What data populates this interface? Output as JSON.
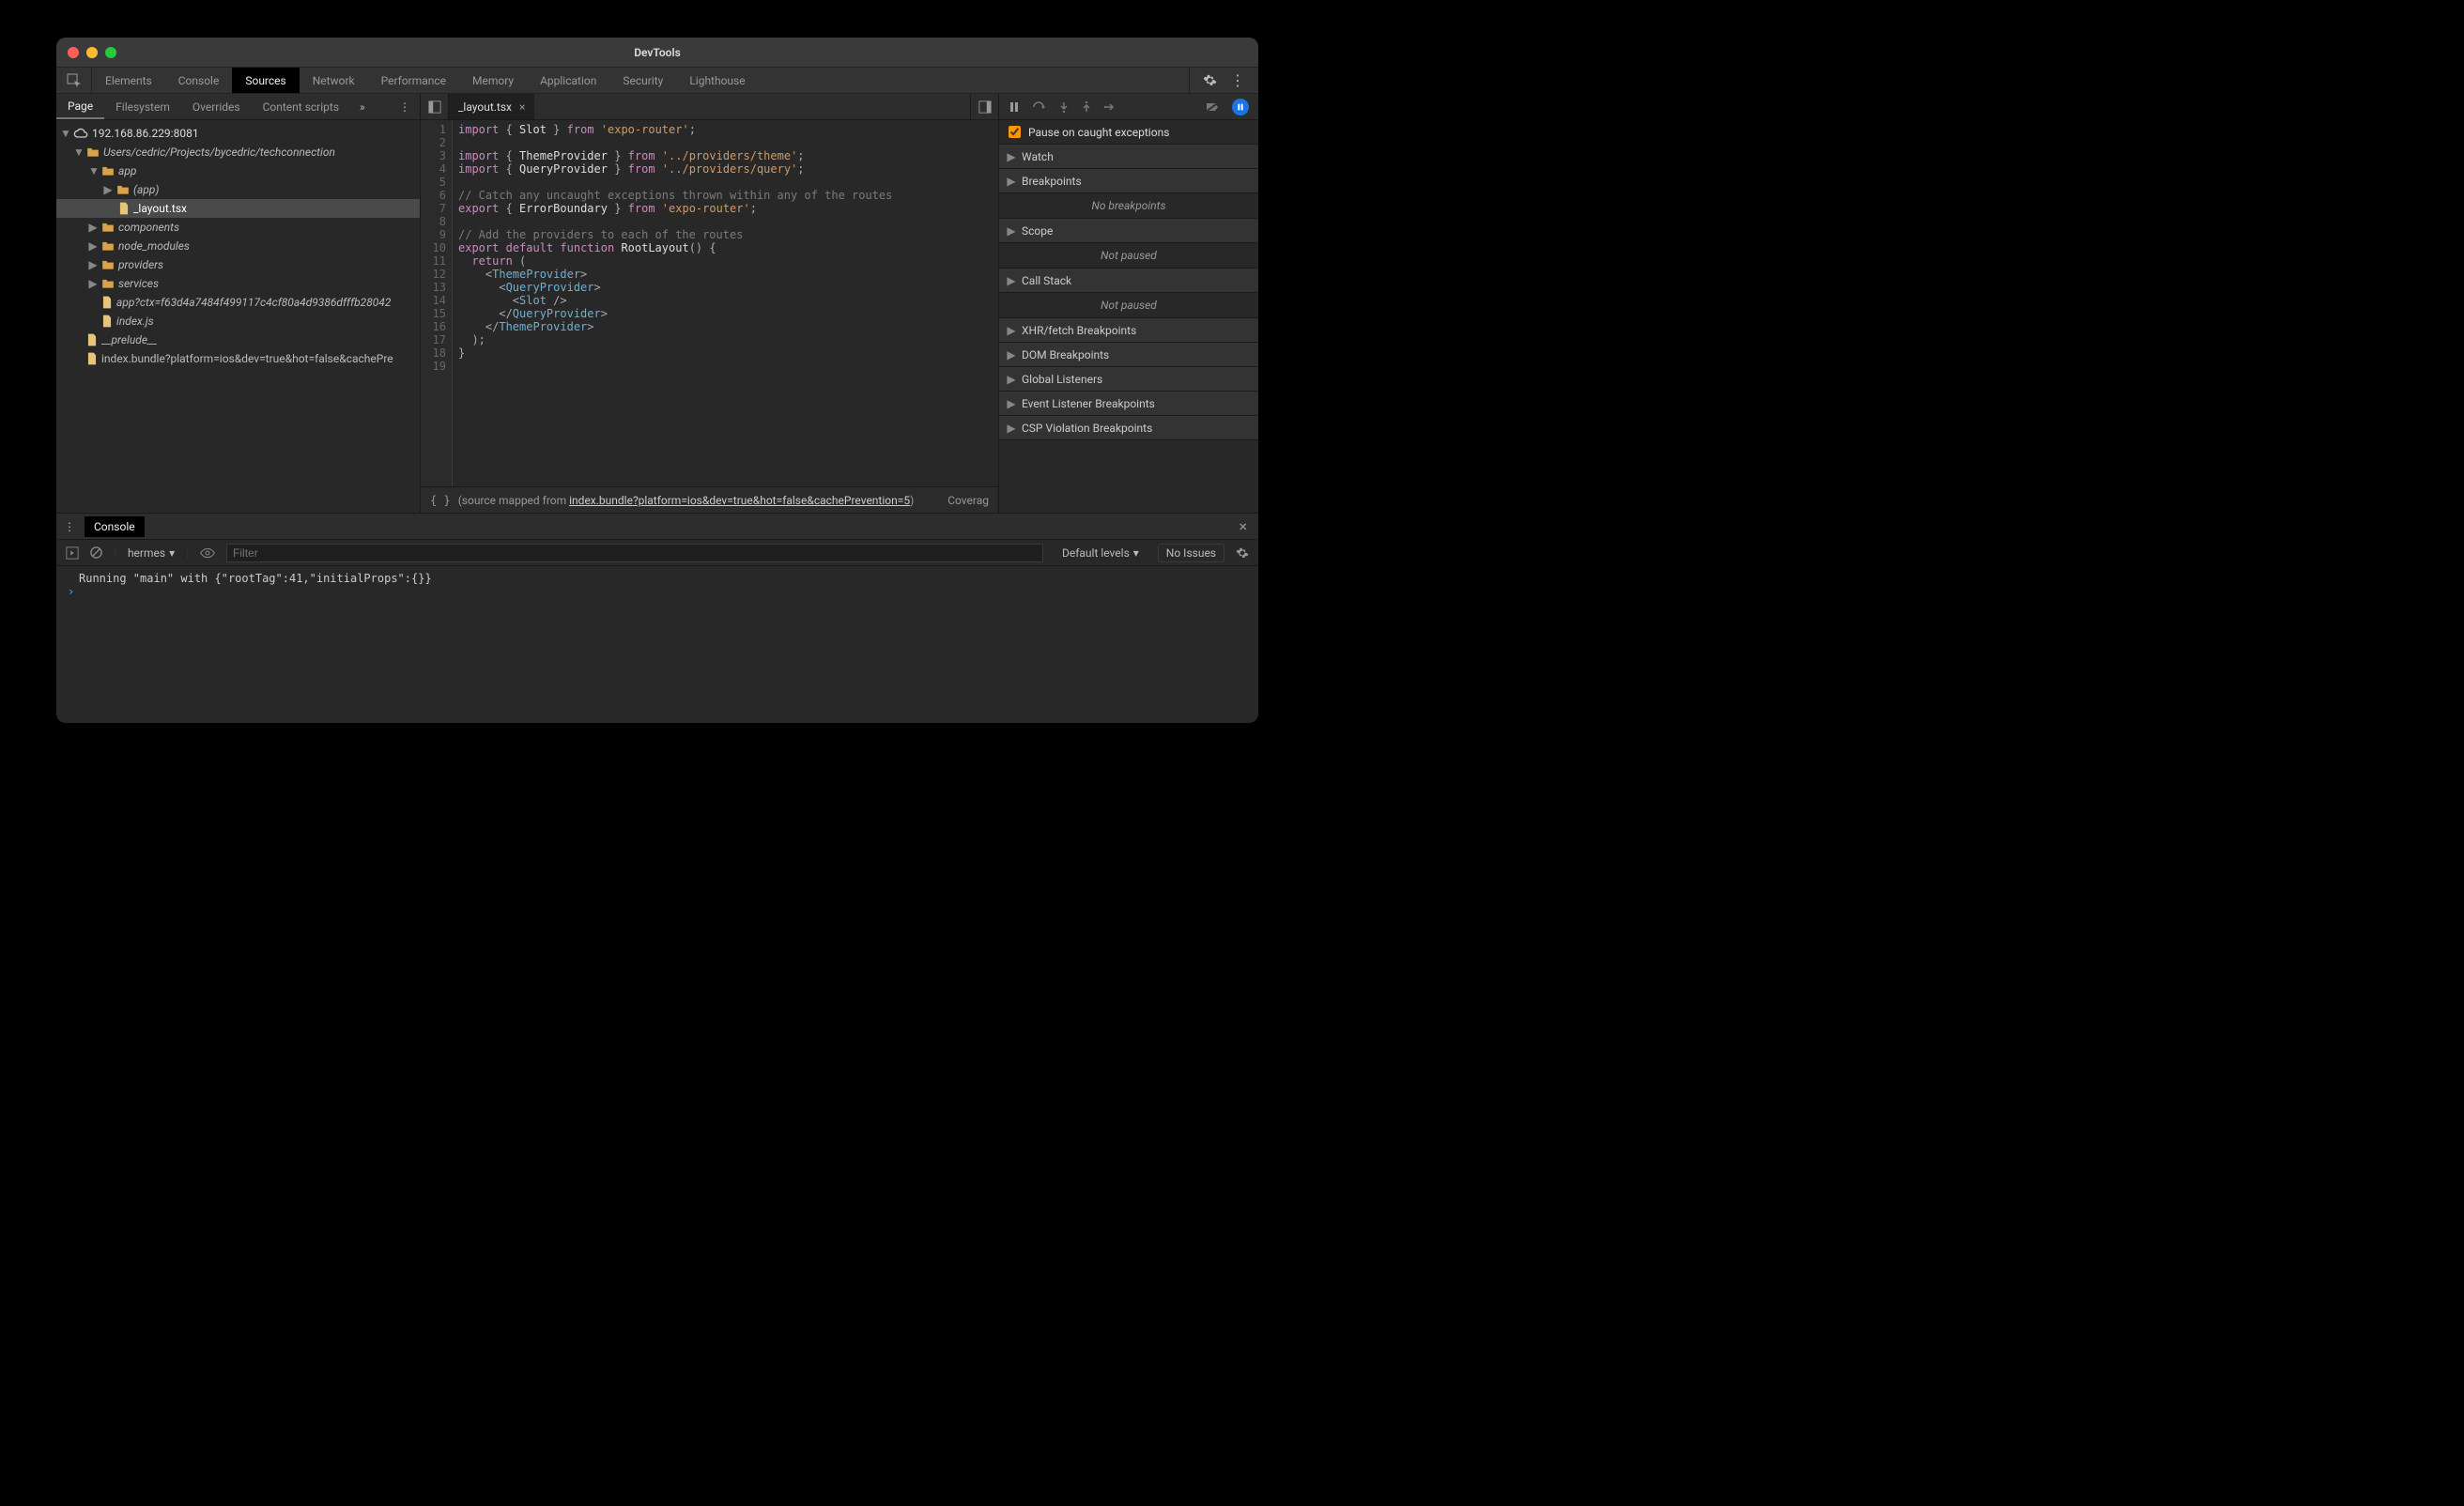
{
  "window_title": "DevTools",
  "main_tabs": [
    "Elements",
    "Console",
    "Sources",
    "Network",
    "Performance",
    "Memory",
    "Application",
    "Security",
    "Lighthouse"
  ],
  "main_tabs_active": "Sources",
  "nav_subtabs": [
    "Page",
    "Filesystem",
    "Overrides",
    "Content scripts"
  ],
  "nav_subtab_active": "Page",
  "tree_host": "192.168.86.229:8081",
  "tree_project_path": "Users/cedric/Projects/bycedric/techconnection",
  "tree": {
    "app": {
      "children": {
        "(app)": {
          "italic": true
        },
        "_layout.tsx": {
          "file": true,
          "selected": true
        }
      }
    },
    "components": {},
    "node_modules": {},
    "providers": {},
    "services": {},
    "app?ctx=f63d4a7484f499117c4cf80a4d9386dfffb28042": {
      "file": true,
      "longname": true
    },
    "index.js": {
      "file": true
    }
  },
  "tree_root_extra": [
    "__prelude__",
    "index.bundle?platform=ios&dev=true&hot=false&cachePre"
  ],
  "editor_tab_name": "_layout.tsx",
  "code_lines": [
    [
      [
        "kw",
        "import"
      ],
      [
        "punct",
        " { "
      ],
      [
        "fn",
        "Slot"
      ],
      [
        "punct",
        " } "
      ],
      [
        "kw",
        "from"
      ],
      [
        "punct",
        " "
      ],
      [
        "str",
        "'expo-router'"
      ],
      [
        "punct",
        ";"
      ]
    ],
    [],
    [
      [
        "kw",
        "import"
      ],
      [
        "punct",
        " { "
      ],
      [
        "fn",
        "ThemeProvider"
      ],
      [
        "punct",
        " } "
      ],
      [
        "kw",
        "from"
      ],
      [
        "punct",
        " "
      ],
      [
        "str",
        "'../providers/theme'"
      ],
      [
        "punct",
        ";"
      ]
    ],
    [
      [
        "kw",
        "import"
      ],
      [
        "punct",
        " { "
      ],
      [
        "fn",
        "QueryProvider"
      ],
      [
        "punct",
        " } "
      ],
      [
        "kw",
        "from"
      ],
      [
        "punct",
        " "
      ],
      [
        "str",
        "'../providers/query'"
      ],
      [
        "punct",
        ";"
      ]
    ],
    [],
    [
      [
        "cmt",
        "// Catch any uncaught exceptions thrown within any of the routes"
      ]
    ],
    [
      [
        "kw",
        "export"
      ],
      [
        "punct",
        " { "
      ],
      [
        "fn",
        "ErrorBoundary"
      ],
      [
        "punct",
        " } "
      ],
      [
        "kw",
        "from"
      ],
      [
        "punct",
        " "
      ],
      [
        "str",
        "'expo-router'"
      ],
      [
        "punct",
        ";"
      ]
    ],
    [],
    [
      [
        "cmt",
        "// Add the providers to each of the routes"
      ]
    ],
    [
      [
        "kw",
        "export"
      ],
      [
        "punct",
        " "
      ],
      [
        "kw",
        "default"
      ],
      [
        "punct",
        " "
      ],
      [
        "kw",
        "function"
      ],
      [
        "punct",
        " "
      ],
      [
        "fn",
        "RootLayout"
      ],
      [
        "punct",
        "() {"
      ]
    ],
    [
      [
        "punct",
        "  "
      ],
      [
        "kw",
        "return"
      ],
      [
        "punct",
        " ("
      ]
    ],
    [
      [
        "punct",
        "    <"
      ],
      [
        "cmp-open",
        "ThemeProvider"
      ],
      [
        "punct",
        ">"
      ]
    ],
    [
      [
        "punct",
        "      <"
      ],
      [
        "cmp-open",
        "QueryProvider"
      ],
      [
        "punct",
        ">"
      ]
    ],
    [
      [
        "punct",
        "        <"
      ],
      [
        "cmp-open",
        "Slot"
      ],
      [
        "punct",
        " />"
      ]
    ],
    [
      [
        "punct",
        "      </"
      ],
      [
        "cmp-open",
        "QueryProvider"
      ],
      [
        "punct",
        ">"
      ]
    ],
    [
      [
        "punct",
        "    </"
      ],
      [
        "cmp-open",
        "ThemeProvider"
      ],
      [
        "punct",
        ">"
      ]
    ],
    [
      [
        "punct",
        "  );"
      ]
    ],
    [
      [
        "punct",
        "}"
      ]
    ],
    []
  ],
  "source_mapped_prefix": "(source mapped from ",
  "source_mapped_link": "index.bundle?platform=ios&dev=true&hot=false&cachePrevention=5",
  "source_mapped_suffix": ")",
  "coverage_label": "Coverag",
  "pause_caught_label": "Pause on caught exceptions",
  "debug_sections": [
    "Watch",
    "Breakpoints",
    "Scope",
    "Call Stack",
    "XHR/fetch Breakpoints",
    "DOM Breakpoints",
    "Global Listeners",
    "Event Listener Breakpoints",
    "CSP Violation Breakpoints"
  ],
  "debug_bodies": {
    "Breakpoints": "No breakpoints",
    "Scope": "Not paused",
    "Call Stack": "Not paused"
  },
  "drawer_tab": "Console",
  "console_ctx": "hermes",
  "filter_placeholder": "Filter",
  "levels_label": "Default levels",
  "issues_label": "No Issues",
  "console_log": "Running \"main\" with {\"rootTag\":41,\"initialProps\":{}}",
  "console_prompt": "›"
}
